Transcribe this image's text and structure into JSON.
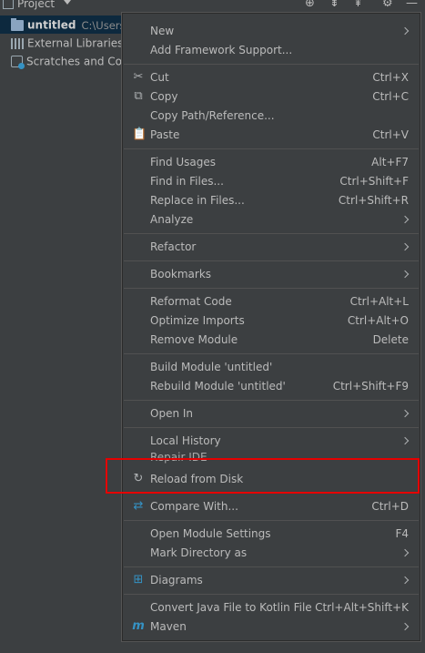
{
  "panel": {
    "title": "Project",
    "tree": [
      {
        "label": "untitled",
        "path": "C:\\Users\\"
      },
      {
        "label": "External Libraries"
      },
      {
        "label": "Scratches and Consoles"
      }
    ]
  },
  "menu": {
    "items": {
      "new": {
        "label": "New"
      },
      "add_framework": {
        "label": "Add Framework Support..."
      },
      "cut": {
        "label": "Cut",
        "shortcut": "Ctrl+X"
      },
      "copy": {
        "label": "Copy",
        "shortcut": "Ctrl+C"
      },
      "copy_path": {
        "label": "Copy Path/Reference..."
      },
      "paste": {
        "label": "Paste",
        "shortcut": "Ctrl+V"
      },
      "find_usages": {
        "label": "Find Usages",
        "shortcut": "Alt+F7"
      },
      "find_in_files": {
        "label": "Find in Files...",
        "shortcut": "Ctrl+Shift+F"
      },
      "replace_in_files": {
        "label": "Replace in Files...",
        "shortcut": "Ctrl+Shift+R"
      },
      "analyze": {
        "label": "Analyze"
      },
      "refactor": {
        "label": "Refactor"
      },
      "bookmarks": {
        "label": "Bookmarks"
      },
      "reformat_code": {
        "label": "Reformat Code",
        "shortcut": "Ctrl+Alt+L"
      },
      "optimize_imports": {
        "label": "Optimize Imports",
        "shortcut": "Ctrl+Alt+O"
      },
      "remove_module": {
        "label": "Remove Module",
        "shortcut": "Delete"
      },
      "build_module": {
        "label": "Build Module 'untitled'"
      },
      "rebuild_module": {
        "label": "Rebuild Module 'untitled'",
        "shortcut": "Ctrl+Shift+F9"
      },
      "open_in": {
        "label": "Open In"
      },
      "local_history": {
        "label": "Local History"
      },
      "repair_ide": {
        "label": "Repair IDE"
      },
      "reload_from_disk": {
        "label": "Reload from Disk"
      },
      "compare_with": {
        "label": "Compare With...",
        "shortcut": "Ctrl+D"
      },
      "open_module_settings": {
        "label": "Open Module Settings",
        "shortcut": "F4"
      },
      "mark_directory_as": {
        "label": "Mark Directory as"
      },
      "diagrams": {
        "label": "Diagrams"
      },
      "convert_kotlin": {
        "label": "Convert Java File to Kotlin File",
        "shortcut": "Ctrl+Alt+Shift+K"
      },
      "maven": {
        "label": "Maven"
      }
    }
  },
  "colors": {
    "background": "#3c3f41",
    "highlight_box": "#e50000",
    "selection": "#0d293e"
  }
}
